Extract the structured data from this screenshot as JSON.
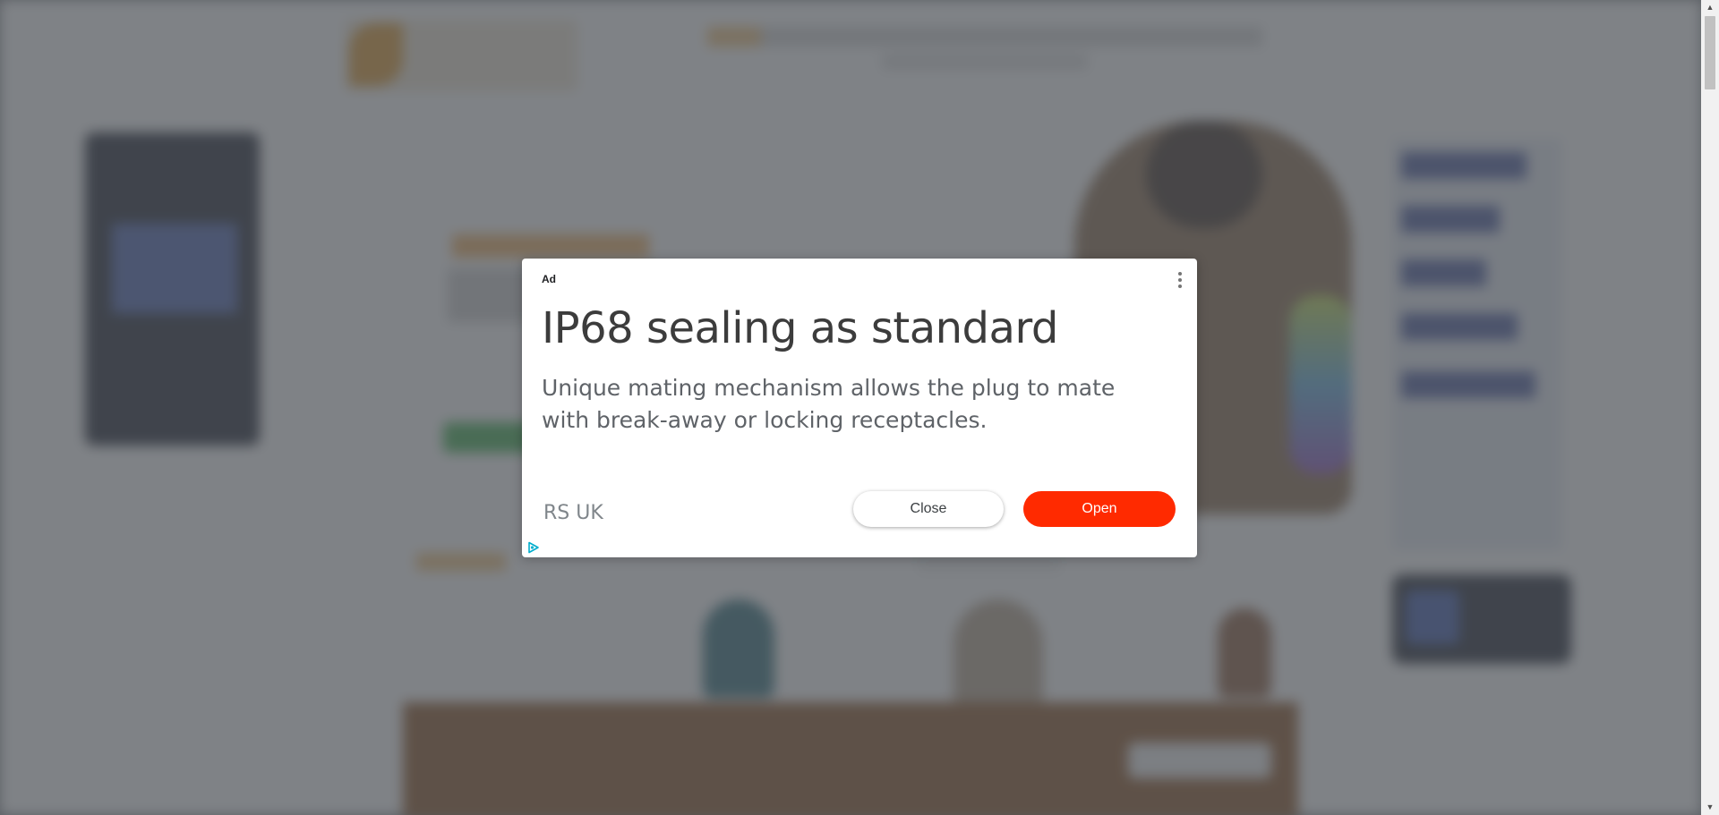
{
  "ad": {
    "label": "Ad",
    "headline": "IP68 sealing as standard",
    "description": "Unique mating mechanism allows the plug to mate with break-away or locking receptacles.",
    "advertiser": "RS UK",
    "close_label": "Close",
    "open_label": "Open",
    "menu_icon": "kebab-menu-icon",
    "adchoices_icon": "adchoices-icon",
    "colors": {
      "open_button": "#ff2a00",
      "headline": "#3c3c3c",
      "adchoices": "#00aecd"
    }
  },
  "scrollbar": {
    "up_arrow": "▲",
    "down_arrow": "▼"
  },
  "background": {
    "overlay_color": "#4e5257"
  }
}
